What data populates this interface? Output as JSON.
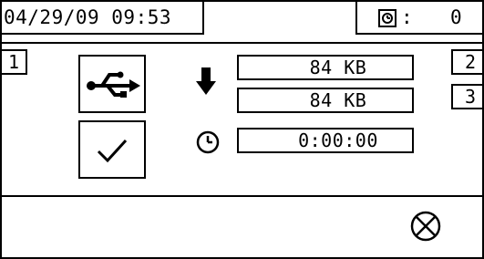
{
  "header": {
    "datetime": "04/29/09 09:53",
    "counter_icon": "cycle-counter-icon",
    "counter_colon": ":",
    "counter_value": "0"
  },
  "tabs": {
    "left": "1",
    "right_top": "2",
    "right_bottom": "3"
  },
  "transfer": {
    "usb_icon": "usb-icon",
    "confirm_icon": "checkmark-icon",
    "download_icon": "down-arrow-icon",
    "time_icon": "clock-icon",
    "download_size": "84 KB",
    "total_size": "84 KB",
    "elapsed_time": "0:00:00"
  },
  "footer": {
    "cancel_icon": "cancel-icon"
  }
}
